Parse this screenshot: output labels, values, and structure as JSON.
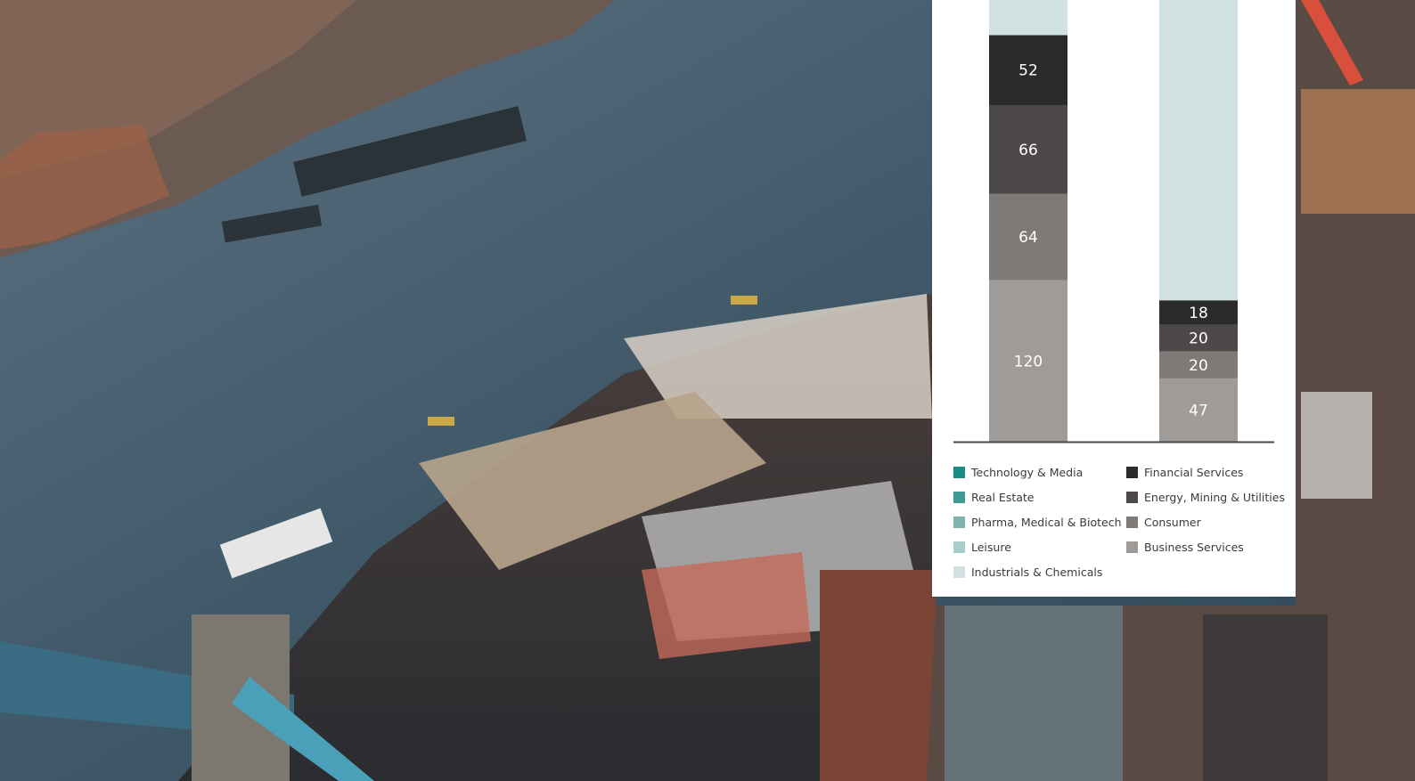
{
  "colors": {
    "Technology & Media": "#1a8a84",
    "Real Estate": "#3f9994",
    "Pharma, Medical & Biotech": "#7eb3b0",
    "Leisure": "#a9cdca",
    "Industrials & Chemicals": "#cfe1e0",
    "Financial Services": "#2b2b2b",
    "Energy, Mining & Utilities": "#4d4948",
    "Consumer": "#7e7a78",
    "Business Services": "#9e9b98"
  },
  "chart_data": {
    "type": "bar",
    "stacked": true,
    "categories": [
      "",
      ""
    ],
    "series": [
      {
        "name": "Business Services",
        "values": [
          120,
          47
        ]
      },
      {
        "name": "Consumer",
        "values": [
          64,
          20
        ]
      },
      {
        "name": "Energy, Mining & Utilities",
        "values": [
          66,
          20
        ]
      },
      {
        "name": "Financial Services",
        "values": [
          52,
          18
        ]
      },
      {
        "name": "Industrials & Chemicals",
        "values": [
          null,
          null
        ]
      }
    ],
    "legend": {
      "left": [
        "Technology & Media",
        "Real Estate",
        "Pharma, Medical & Biotech",
        "Leisure",
        "Industrials & Chemicals"
      ],
      "right": [
        "Financial Services",
        "Energy, Mining & Utilities",
        "Consumer",
        "Business Services"
      ],
      "placement": "bottom"
    },
    "grid": false
  }
}
